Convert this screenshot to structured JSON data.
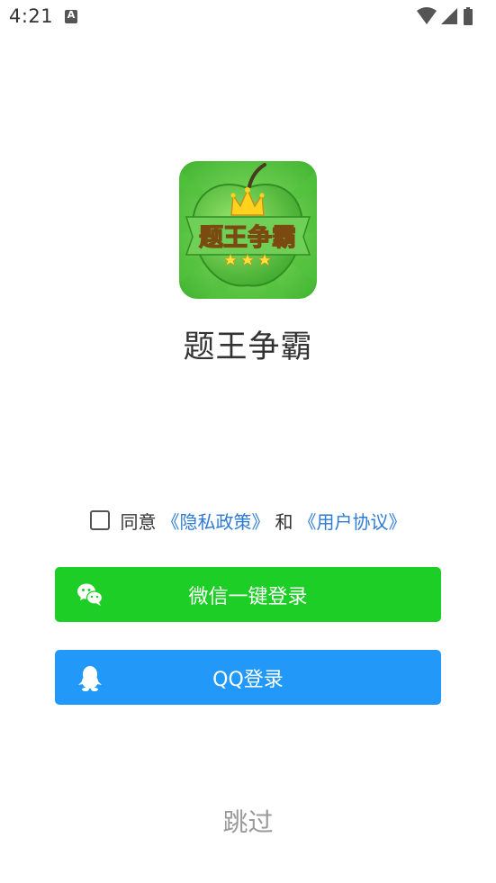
{
  "status_bar": {
    "time": "4:21",
    "notification_icon": "a-icon",
    "icons": [
      "wifi-icon",
      "signal-icon",
      "battery-icon"
    ]
  },
  "app": {
    "logo_text": "题王争霸",
    "name": "题王争霸"
  },
  "agreement": {
    "checked": false,
    "prefix": "同意",
    "privacy_link": "《隐私政策》",
    "and": "和",
    "user_link": "《用户协议》"
  },
  "buttons": {
    "wechat_label": "微信一键登录",
    "qq_label": "QQ登录",
    "skip_label": "跳过"
  },
  "colors": {
    "wechat_green": "#1cce25",
    "qq_blue": "#2299f8",
    "link_blue": "#2e7bd6",
    "skip_gray": "#9a9a9a"
  }
}
